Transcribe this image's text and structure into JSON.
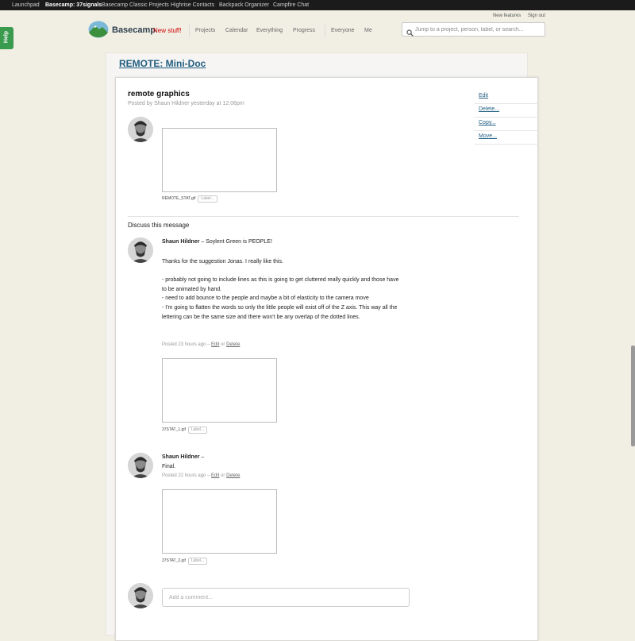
{
  "topbar": {
    "links": [
      "Launchpad",
      "Basecamp: 37signals",
      "Basecamp Classic Projects",
      "Highrise Contacts",
      "Backpack Organizer",
      "Campfire Chat"
    ]
  },
  "help": {
    "label": "Help"
  },
  "header": {
    "util_links": [
      "New features",
      "Sign out"
    ],
    "logo": "Basecamp",
    "new_stuff": "New stuff!",
    "nav": [
      "Projects",
      "Calendar",
      "Everything",
      "Progress",
      "Everyone",
      "Me"
    ],
    "search_placeholder": "Jump to a project, person, label, or search..."
  },
  "doc": {
    "title": "REMOTE: Mini-Doc"
  },
  "message": {
    "title": "remote graphics",
    "posted_by": "Posted by Shaun Hildner yesterday at 12:06pm",
    "actions": [
      "Edit",
      "Delete...",
      "Copy...",
      "Move..."
    ],
    "attachment": {
      "filename": "REMOTE_STAT.gif",
      "label_button": "Label..."
    }
  },
  "discuss": {
    "heading": "Discuss this message"
  },
  "comments": [
    {
      "author": "Shaun Hildner",
      "dash": " – ",
      "headline": "Soylent Green is PEOPLE!",
      "paragraphs": [
        "Thanks for the suggestion Jonas.  I really like this.",
        "- probably not going to include lines as this is going to get cluttered really quickly and those have to be animated by hand.",
        "- need to add bounce to the people and maybe a bit of elasticity to the camera move",
        "- I'm going to flatten the words so only the little people will exist off of the Z axis.  This way all the lettering can be the same size and there won't be any overlap of the dotted lines."
      ],
      "meta_prefix": "Posted 23 hours ago – ",
      "edit": "Edit",
      "or": " or ",
      "delete": "Delete",
      "attachment": {
        "filename": "37STAT_1.gif",
        "label_button": "Label..."
      }
    },
    {
      "author": "Shaun Hildner",
      "dash": " –",
      "body": "Final.",
      "meta_prefix": "Posted 22 hours ago – ",
      "edit": "Edit",
      "or": " or ",
      "delete": "Delete",
      "attachment": {
        "filename": "37STAT_2.gif",
        "label_button": "Label..."
      }
    }
  ],
  "add_comment": {
    "placeholder": "Add a comment..."
  },
  "colors": {
    "page_bg": "#f1efe4",
    "topbar": "#1b1b1b",
    "help_green": "#3a9a4e",
    "link_blue": "#1f5d80",
    "new_stuff_red": "#cc0000"
  }
}
